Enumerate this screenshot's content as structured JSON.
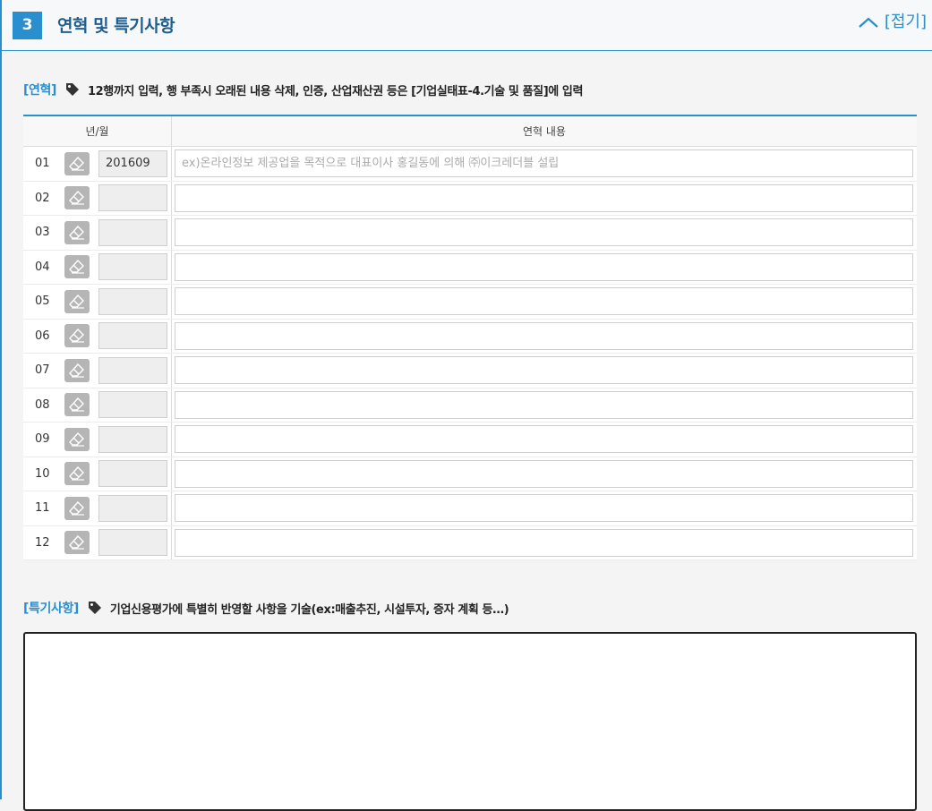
{
  "section": {
    "number": "3",
    "title": "연혁 및 특기사항",
    "collapse_label": "[접기]"
  },
  "history": {
    "tag": "[연혁]",
    "instruction": "12행까지 입력, 행 부족시 오래된 내용 삭제, 인증, 산업재산권 등은 [기업실태표-4.기술 및 품질]에 입력",
    "columns": {
      "year_month": "년/월",
      "content": "연혁 내용"
    },
    "rows": [
      {
        "no": "01",
        "year_month": "201609",
        "content_placeholder": "ex)온라인정보 제공업을 목적으로 대표이사 홍길동에 의해 ㈜이크레더블 설립"
      },
      {
        "no": "02",
        "year_month": "",
        "content_placeholder": ""
      },
      {
        "no": "03",
        "year_month": "",
        "content_placeholder": ""
      },
      {
        "no": "04",
        "year_month": "",
        "content_placeholder": ""
      },
      {
        "no": "05",
        "year_month": "",
        "content_placeholder": ""
      },
      {
        "no": "06",
        "year_month": "",
        "content_placeholder": ""
      },
      {
        "no": "07",
        "year_month": "",
        "content_placeholder": ""
      },
      {
        "no": "08",
        "year_month": "",
        "content_placeholder": ""
      },
      {
        "no": "09",
        "year_month": "",
        "content_placeholder": ""
      },
      {
        "no": "10",
        "year_month": "",
        "content_placeholder": ""
      },
      {
        "no": "11",
        "year_month": "",
        "content_placeholder": ""
      },
      {
        "no": "12",
        "year_month": "",
        "content_placeholder": ""
      }
    ]
  },
  "special": {
    "tag": "[특기사항]",
    "instruction": "기업신용평가에 특별히 반영할 사항을 기술(ex:매출추진, 시설투자, 증자 계획 등…)",
    "value": ""
  },
  "icons": {
    "tag": "tag-icon",
    "eraser": "eraser-icon",
    "collapse": "chevron-up-icon"
  },
  "colors": {
    "accent": "#2a8fce",
    "title": "#1f5f8f"
  }
}
